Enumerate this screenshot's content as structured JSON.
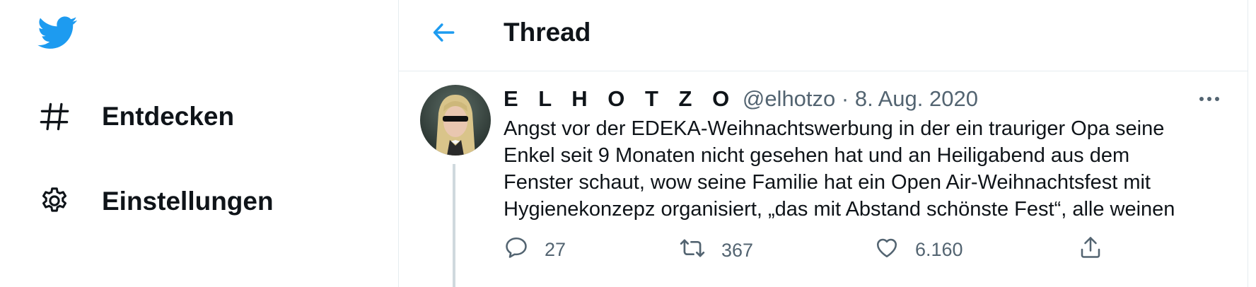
{
  "sidebar": {
    "logo_icon": "twitter-bird-icon",
    "items": [
      {
        "icon": "hashtag-icon",
        "label": "Entdecken"
      },
      {
        "icon": "gear-icon",
        "label": "Einstellungen"
      }
    ]
  },
  "header": {
    "back_icon": "arrow-left-icon",
    "title": "Thread"
  },
  "tweet": {
    "display_name": "E L H O T Z O",
    "handle": "@elhotzo",
    "separator": "·",
    "date": "8. Aug. 2020",
    "text_lines": [
      "Angst vor der EDEKA-Weihnachtswerbung in der ein trauriger Opa seine",
      "Enkel seit 9 Monaten nicht gesehen hat und an Heiligabend aus dem",
      "Fenster schaut, wow seine Familie hat ein Open Air-Weihnachtsfest mit",
      "Hygienekonzepz organisiert, „das mit Abstand schönste Fest“, alle weinen"
    ],
    "actions": {
      "reply": {
        "icon": "reply-icon",
        "count": "27"
      },
      "retweet": {
        "icon": "retweet-icon",
        "count": "367"
      },
      "like": {
        "icon": "heart-icon",
        "count": "6.160"
      },
      "share": {
        "icon": "share-icon"
      }
    }
  },
  "colors": {
    "brand": "#1d9bf0",
    "text": "#0f1419",
    "secondary": "#536471",
    "border": "#e6ecf0"
  }
}
